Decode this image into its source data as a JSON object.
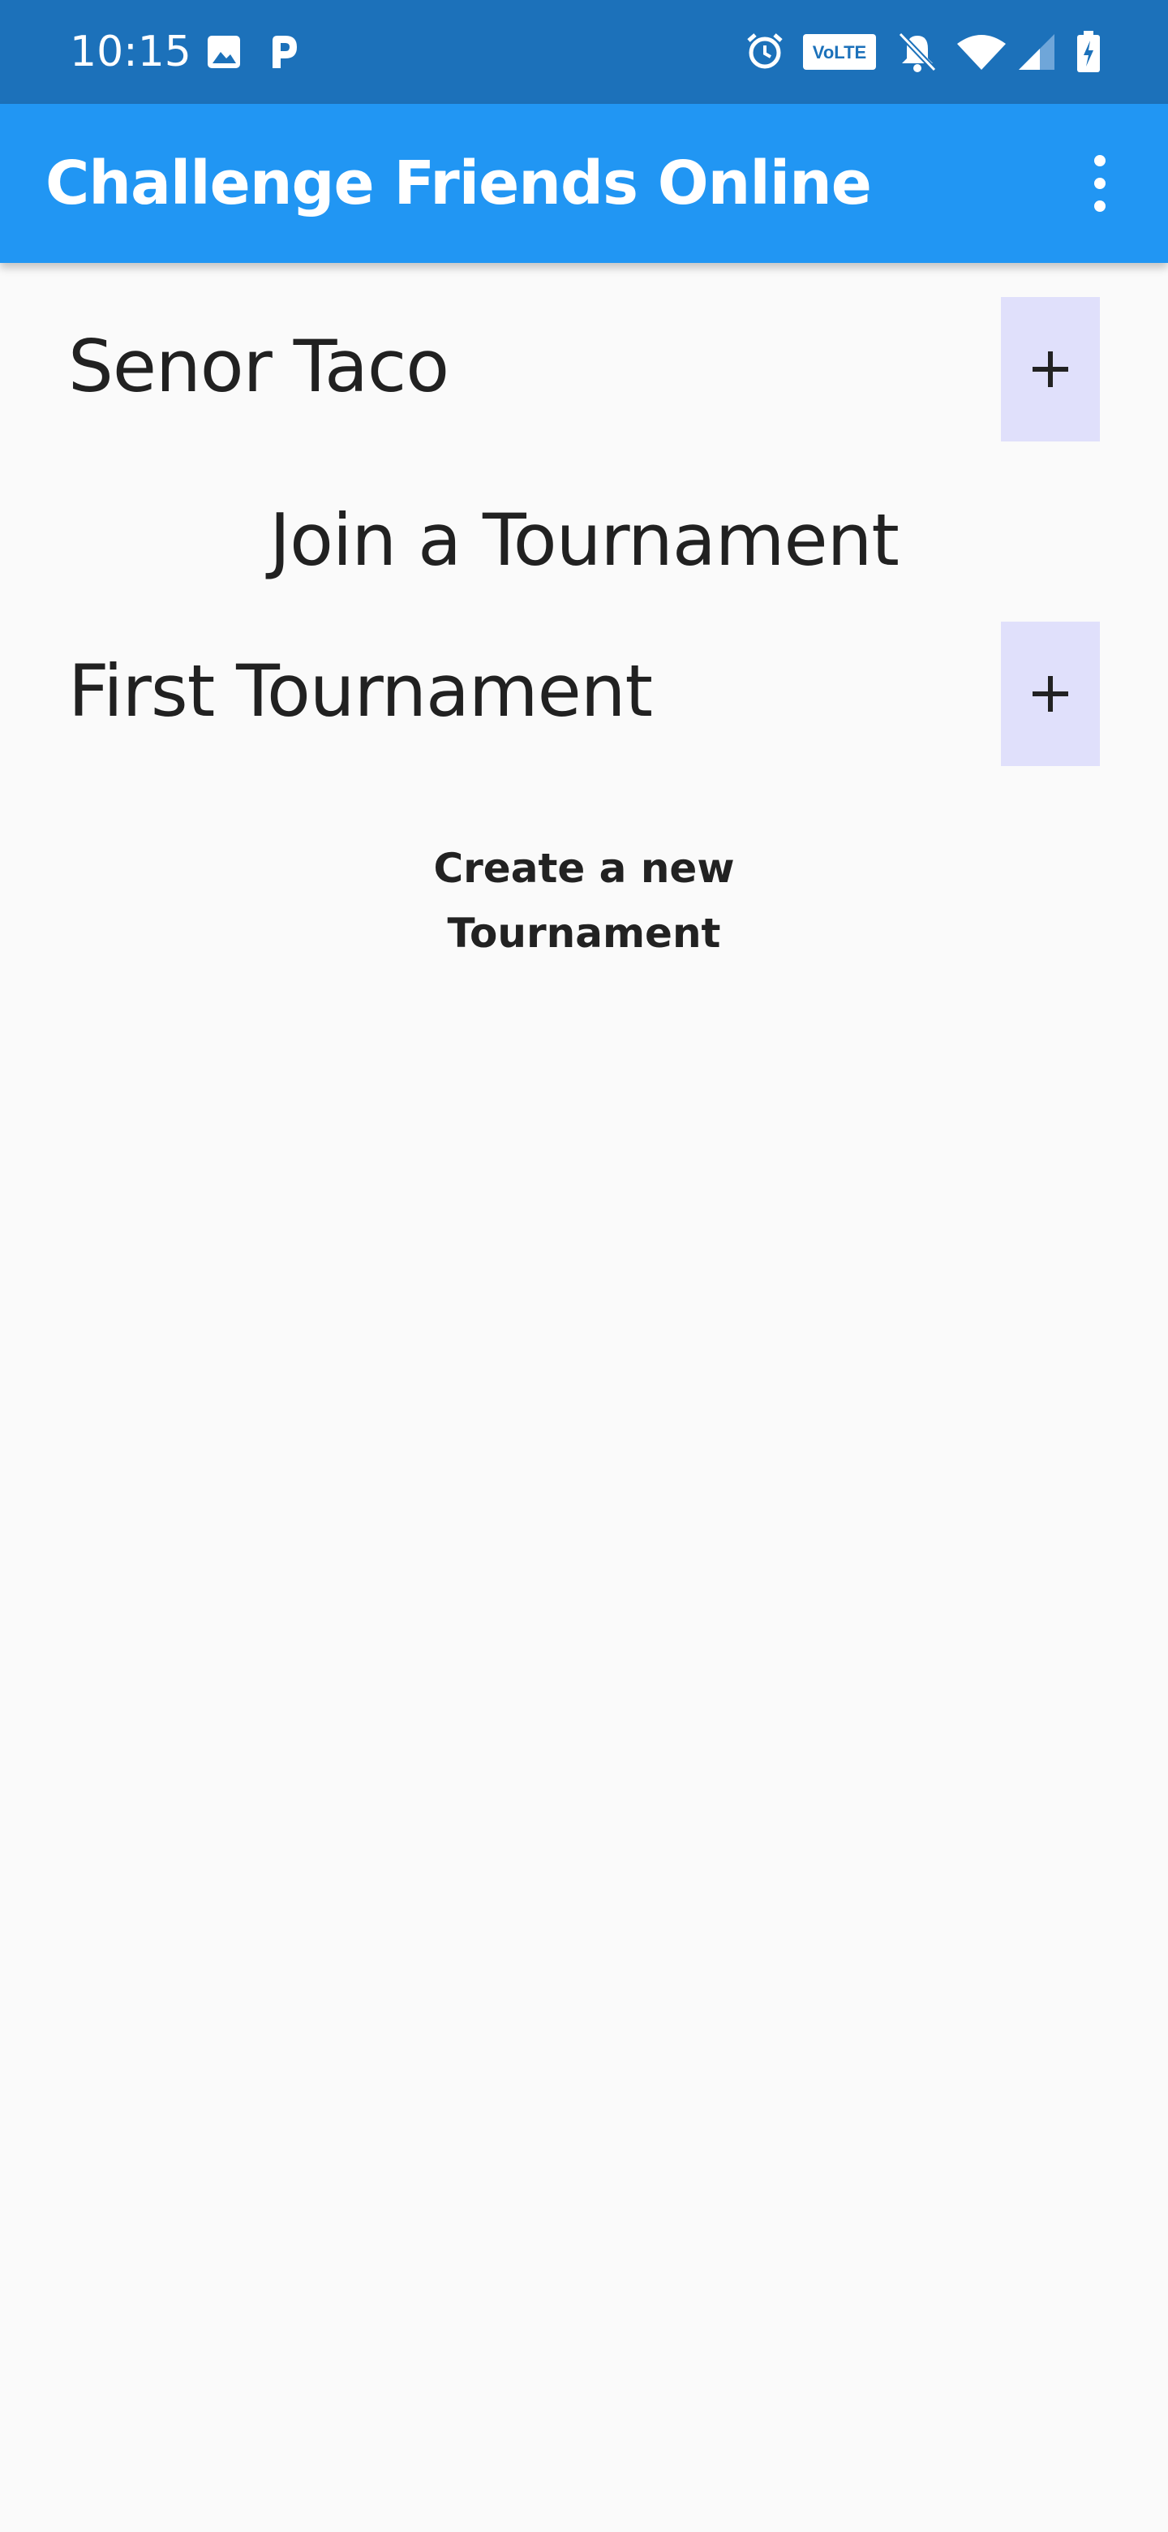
{
  "status_bar": {
    "time": "10:15",
    "icons": [
      "image-icon",
      "parking-icon",
      "alarm-icon",
      "volte-icon",
      "bell-off-icon",
      "wifi-icon",
      "signal-icon",
      "battery-charging-icon"
    ],
    "volte_label": "VoLTE"
  },
  "app_bar": {
    "title": "Challenge Friends Online",
    "overflow_icon": "more-vert-icon"
  },
  "main": {
    "joined_tournaments": [
      {
        "label": "Senor Taco",
        "action_label": "+"
      }
    ],
    "join_heading": "Join a Tournament",
    "available_tournaments": [
      {
        "label": "First Tournament",
        "action_label": "+"
      }
    ],
    "create_label": "Create a new Tournament"
  },
  "colors": {
    "status_bar": "#1c71ba",
    "app_bar": "#2196f3",
    "background": "#fafafa",
    "add_button": "#e0e0fb",
    "text": "#212121"
  }
}
